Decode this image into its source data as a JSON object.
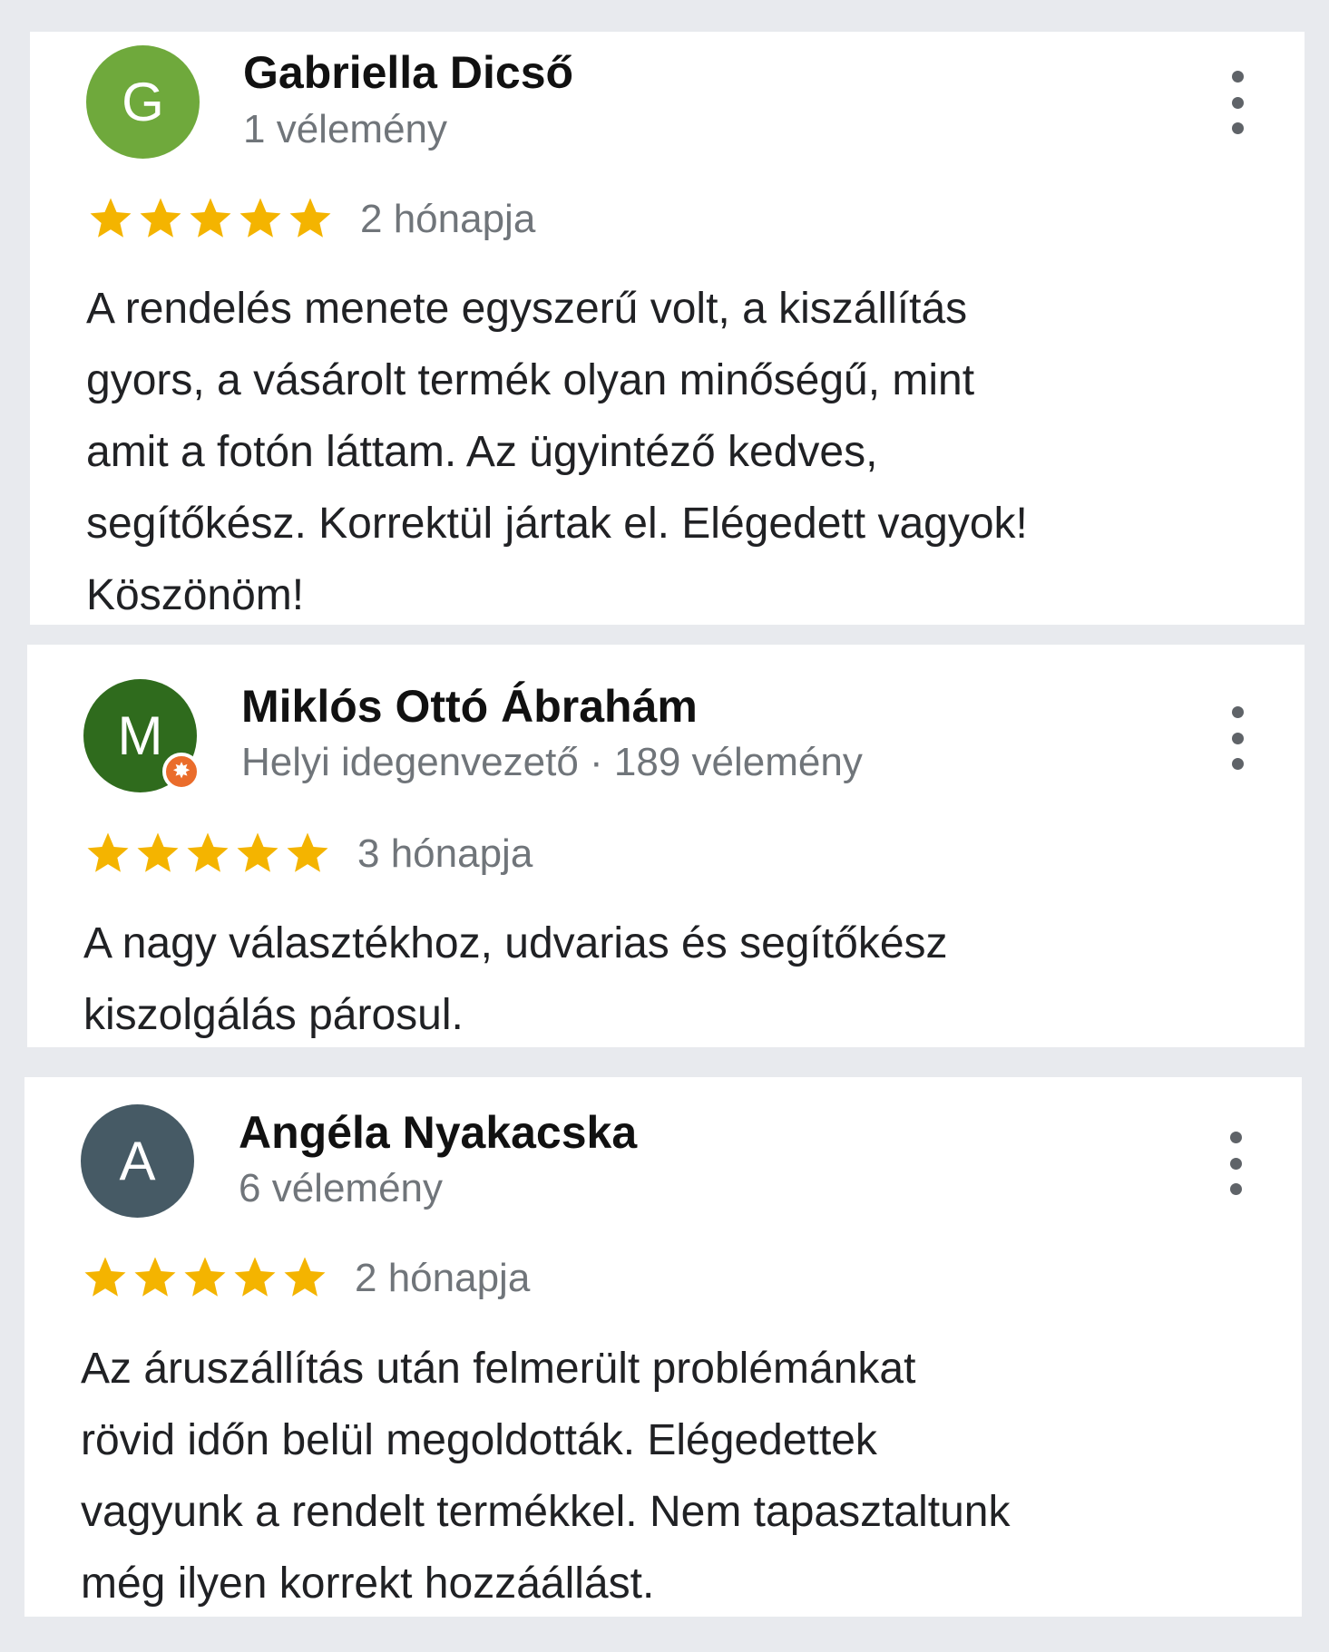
{
  "reviews": [
    {
      "avatar_letter": "G",
      "avatar_color": "#6fa93c",
      "name": "Gabriella Dicső",
      "meta": "1 vélemény",
      "rating": 5,
      "date": "2 hónapja",
      "text": "A rendelés menete egyszerű volt, a kiszállítás\ngyors, a vásárolt termék olyan minőségű, mint\namit a fotón láttam. Az ügyintéző kedves,\nsegítőkész. Korrektül jártak el. Elégedett vagyok!\nKöszönöm!"
    },
    {
      "avatar_letter": "M",
      "avatar_color": "#2f6b1d",
      "local_guide": true,
      "name": "Miklós Ottó Ábrahám",
      "meta": "Helyi idegenvezető · 189 vélemény",
      "rating": 5,
      "date": "3 hónapja",
      "text": "A nagy választékhoz, udvarias és segítőkész\nkiszolgálás párosul."
    },
    {
      "avatar_letter": "A",
      "avatar_color": "#465a65",
      "name": "Angéla Nyakacska",
      "meta": "6 vélemény",
      "rating": 5,
      "date": "2 hónapja",
      "text": "Az áruszállítás után felmerült problémánkat\nrövid időn belül megoldották.  Elégedettek\nvagyunk a rendelt termékkel.  Nem tapasztaltunk\nmég ilyen korrekt hozzáállást."
    }
  ],
  "colors": {
    "star": "#f4b400",
    "background": "#e8eaee",
    "card": "#ffffff",
    "secondary_text": "#70757a"
  },
  "icons": {
    "more": "more-vert-icon",
    "star": "star-icon",
    "guide": "local-guide-badge-icon"
  }
}
